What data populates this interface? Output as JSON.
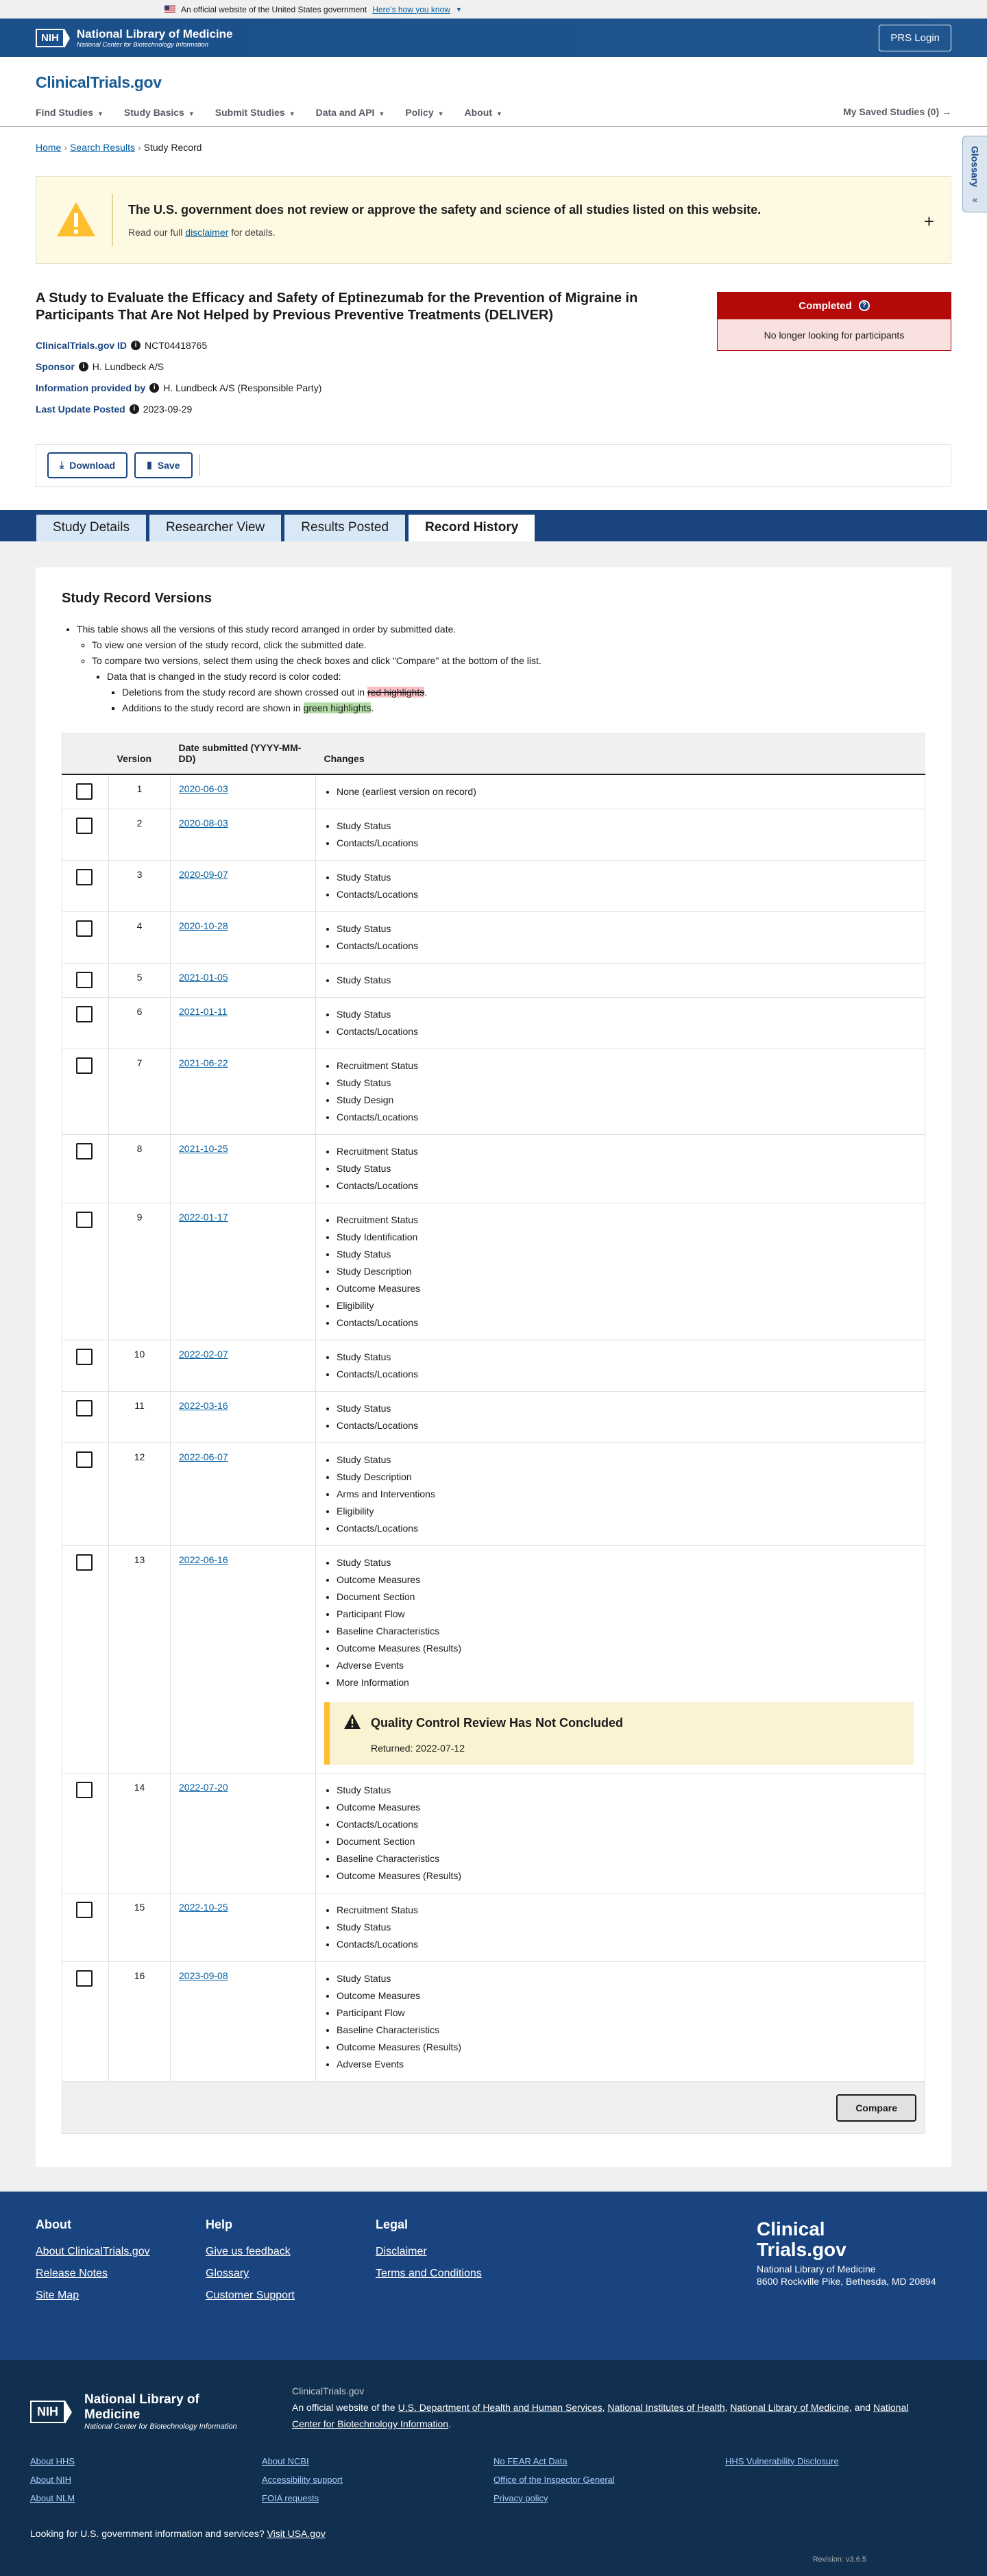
{
  "gov_banner": {
    "text": "An official website of the United States government",
    "link": "Here's how you know"
  },
  "nlm_header": {
    "logo": "NIH",
    "title": "National Library of Medicine",
    "subtitle": "National Center for Biotechnology Information",
    "prs_login": "PRS Login"
  },
  "ct_header": {
    "logo": "ClinicalTrials.gov",
    "nav": [
      "Find Studies",
      "Study Basics",
      "Submit Studies",
      "Data and API",
      "Policy",
      "About"
    ],
    "saved": "My Saved Studies (0)"
  },
  "breadcrumb": [
    "Home",
    "Search Results",
    "Study Record"
  ],
  "glossary": "Glossary",
  "disclaimer": {
    "title": "The U.S. government does not review or approve the safety and science of all studies listed on this website.",
    "text_pre": "Read our full",
    "link": "disclaimer",
    "text_post": "for details."
  },
  "study": {
    "title": "A Study to Evaluate the Efficacy and Safety of Eptinezumab for the Prevention of Migraine in Participants That Are Not Helped by Previous Preventive Treatments (DELIVER)",
    "id_label": "ClinicalTrials.gov ID",
    "id": "NCT04418765",
    "sponsor_label": "Sponsor",
    "sponsor": "H. Lundbeck A/S",
    "info_label": "Information provided by",
    "info": "H. Lundbeck A/S (Responsible Party)",
    "update_label": "Last Update Posted",
    "update": "2023-09-29",
    "status": "Completed",
    "status_note": "No longer looking for participants"
  },
  "actions": {
    "download": "Download",
    "save": "Save"
  },
  "tabs": [
    "Study Details",
    "Researcher View",
    "Results Posted",
    "Record History"
  ],
  "record": {
    "title": "Study Record Versions",
    "intro": "This table shows all the versions of this study record arranged in order by submitted date.",
    "view_one": "To view one version of the study record, click the submitted date.",
    "compare_two": "To compare two versions, select them using the check boxes and click \"Compare\" at the bottom of the list.",
    "color_coded": "Data that is changed in the study record is color coded:",
    "deletions_pre": "Deletions from the study record are shown crossed out in",
    "deletions_hl": "red highlights",
    "additions_pre": "Additions to the study record are shown in",
    "additions_hl": "green highlights",
    "col_version": "Version",
    "col_date": "Date submitted (YYYY-MM-DD)",
    "col_changes": "Changes",
    "compare": "Compare",
    "qc_title": "Quality Control Review Has Not Concluded",
    "qc_returned": "Returned: 2022-07-12"
  },
  "versions": [
    {
      "version": "1",
      "date": "2020-06-03",
      "changes": [
        "None (earliest version on record)"
      ]
    },
    {
      "version": "2",
      "date": "2020-08-03",
      "changes": [
        "Study Status",
        "Contacts/Locations"
      ]
    },
    {
      "version": "3",
      "date": "2020-09-07",
      "changes": [
        "Study Status",
        "Contacts/Locations"
      ]
    },
    {
      "version": "4",
      "date": "2020-10-28",
      "changes": [
        "Study Status",
        "Contacts/Locations"
      ]
    },
    {
      "version": "5",
      "date": "2021-01-05",
      "changes": [
        "Study Status"
      ]
    },
    {
      "version": "6",
      "date": "2021-01-11",
      "changes": [
        "Study Status",
        "Contacts/Locations"
      ]
    },
    {
      "version": "7",
      "date": "2021-06-22",
      "changes": [
        "Recruitment Status",
        "Study Status",
        "Study Design",
        "Contacts/Locations"
      ]
    },
    {
      "version": "8",
      "date": "2021-10-25",
      "changes": [
        "Recruitment Status",
        "Study Status",
        "Contacts/Locations"
      ]
    },
    {
      "version": "9",
      "date": "2022-01-17",
      "changes": [
        "Recruitment Status",
        "Study Identification",
        "Study Status",
        "Study Description",
        "Outcome Measures",
        "Eligibility",
        "Contacts/Locations"
      ]
    },
    {
      "version": "10",
      "date": "2022-02-07",
      "changes": [
        "Study Status",
        "Contacts/Locations"
      ]
    },
    {
      "version": "11",
      "date": "2022-03-16",
      "changes": [
        "Study Status",
        "Contacts/Locations"
      ]
    },
    {
      "version": "12",
      "date": "2022-06-07",
      "changes": [
        "Study Status",
        "Study Description",
        "Arms and Interventions",
        "Eligibility",
        "Contacts/Locations"
      ]
    },
    {
      "version": "13",
      "date": "2022-06-16",
      "changes": [
        "Study Status",
        "Outcome Measures",
        "Document Section",
        "Participant Flow",
        "Baseline Characteristics",
        "Outcome Measures (Results)",
        "Adverse Events",
        "More Information"
      ],
      "qc": true
    },
    {
      "version": "14",
      "date": "2022-07-20",
      "changes": [
        "Study Status",
        "Outcome Measures",
        "Contacts/Locations",
        "Document Section",
        "Baseline Characteristics",
        "Outcome Measures (Results)"
      ]
    },
    {
      "version": "15",
      "date": "2022-10-25",
      "changes": [
        "Recruitment Status",
        "Study Status",
        "Contacts/Locations"
      ]
    },
    {
      "version": "16",
      "date": "2023-09-08",
      "changes": [
        "Study Status",
        "Outcome Measures",
        "Participant Flow",
        "Baseline Characteristics",
        "Outcome Measures (Results)",
        "Adverse Events"
      ]
    }
  ],
  "footer": {
    "about_head": "About",
    "about_links": [
      "About ClinicalTrials.gov",
      "Release Notes",
      "Site Map"
    ],
    "help_head": "Help",
    "help_links": [
      "Give us feedback",
      "Glossary",
      "Customer Support"
    ],
    "legal_head": "Legal",
    "legal_links": [
      "Disclaimer",
      "Terms and Conditions"
    ],
    "logo_line1": "Clinical",
    "logo_line2": "Trials.gov",
    "addr1": "National Library of Medicine",
    "addr2": "8600 Rockville Pike, Bethesda, MD 20894"
  },
  "footer_nlm": {
    "logo": "NIH",
    "title": "National Library of Medicine",
    "subtitle": "National Center for Biotechnology Information",
    "site": "ClinicalTrials.gov",
    "official_pre": "An official website of the",
    "hhs": "U.S. Department of Health and Human Services",
    "nih": "National Institutes of Health",
    "nlm": "National Library of Medicine",
    "and": "and",
    "ncbi": "National Center for Biotechnology Information",
    "col1": [
      "About HHS",
      "About NIH",
      "About NLM"
    ],
    "col2": [
      "About NCBI",
      "Accessibility support",
      "FOIA requests"
    ],
    "col3": [
      "No FEAR Act Data",
      "Office of the Inspector General",
      "Privacy policy"
    ],
    "col4": [
      "HHS Vulnerability Disclosure"
    ],
    "gov_q": "Looking for U.S. government information and services?",
    "usa": "Visit USA.gov",
    "revision": "Revision: v3.6.5"
  }
}
